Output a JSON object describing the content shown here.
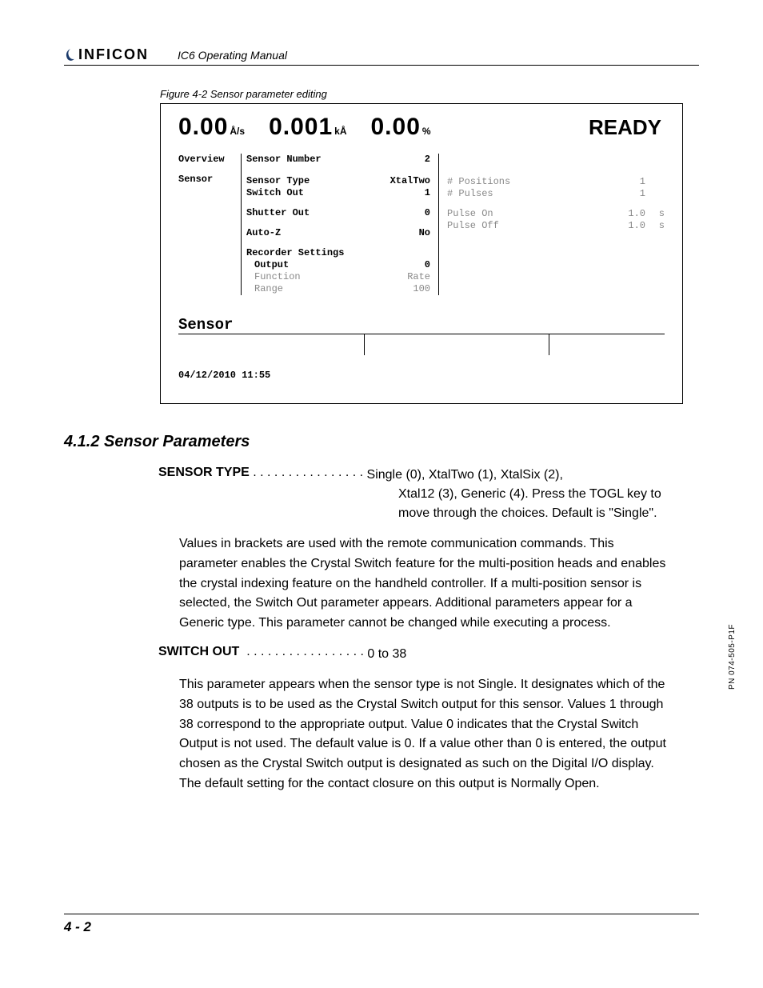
{
  "header": {
    "brand": "INFICON",
    "doc_title": "IC6 Operating Manual"
  },
  "figure": {
    "caption": "Figure 4-2  Sensor parameter editing",
    "readout": {
      "rate_val": "0.00",
      "rate_unit": "Å/s",
      "thick_val": "0.001",
      "thick_unit": "kÅ",
      "pct_val": "0.00",
      "pct_unit": "%",
      "status": "READY"
    },
    "nav": {
      "item1": "Overview",
      "item2": "Sensor"
    },
    "left": {
      "sensor_number_lbl": "Sensor Number",
      "sensor_number_val": "2",
      "sensor_type_lbl": "Sensor Type",
      "sensor_type_val": "XtalTwo",
      "switch_out_lbl": "Switch Out",
      "switch_out_val": "1",
      "shutter_out_lbl": "Shutter Out",
      "shutter_out_val": "0",
      "autoz_lbl": "Auto-Z",
      "autoz_val": "No",
      "rec_settings_lbl": "Recorder Settings",
      "output_lbl": "Output",
      "output_val": "0",
      "function_lbl": "Function",
      "function_val": "Rate",
      "range_lbl": "Range",
      "range_val": "100"
    },
    "right": {
      "positions_lbl": "# Positions",
      "positions_val": "1",
      "pulses_lbl": "# Pulses",
      "pulses_val": "1",
      "pulse_on_lbl": "Pulse On",
      "pulse_on_val": "1.0",
      "pulse_on_unit": "s",
      "pulse_off_lbl": "Pulse Off",
      "pulse_off_val": "1.0",
      "pulse_off_unit": "s"
    },
    "mode_label": "Sensor",
    "timestamp": "04/12/2010  11:55"
  },
  "section": {
    "heading": "4.1.2  Sensor Parameters"
  },
  "params": {
    "sensor_type": {
      "term": "SENSOR TYPE",
      "dots": " . . . . . . . . . . . . . . . . ",
      "def_line1": "Single (0), XtalTwo (1), XtalSix (2),",
      "def_rest": "Xtal12 (3), Generic (4). Press the TOGL key to move through the choices. Default is \"Single\"."
    },
    "switch_out": {
      "term": "SWITCH OUT",
      "dots": "  . . . . . . . . . . . . . . . . . ",
      "range": "0 to 38"
    }
  },
  "body": {
    "p1": "Values in brackets are used with the remote communication commands. This parameter enables the Crystal Switch feature for the multi-position heads and enables the crystal indexing feature on the handheld controller. If a multi-position sensor is selected, the Switch Out parameter appears. Additional parameters appear for a Generic type. This parameter cannot be changed while executing a process.",
    "p2": "This parameter appears when the sensor type is not Single. It designates which of the 38 outputs is to be used as the Crystal Switch output for this sensor. Values 1 through 38 correspond to the appropriate output. Value 0 indicates that the Crystal Switch Output is not used. The default value is 0. If a value other than 0 is entered, the output chosen as the Crystal Switch output is designated as such on the Digital I/O display. The default setting for the contact closure on this output is Normally Open."
  },
  "side_pn": "PN 074-505-P1F",
  "footer": {
    "page": "4 - 2"
  }
}
